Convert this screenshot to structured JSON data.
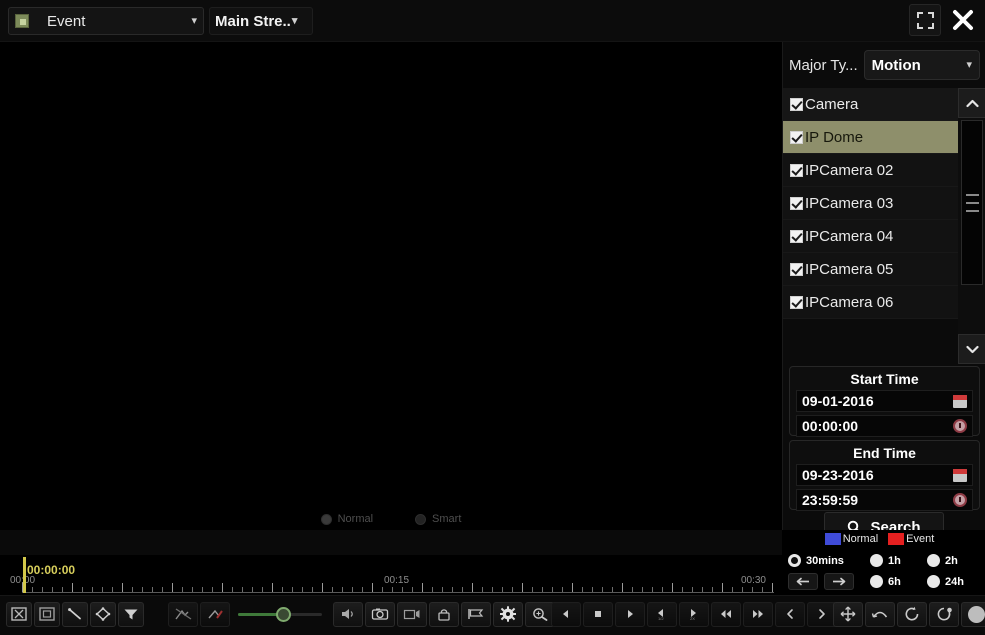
{
  "topbar": {
    "event_type": "Event",
    "stream_type": "Main Stre..",
    "maximize_icon": "fullscreen-icon",
    "close_icon": "close-icon"
  },
  "view_modes": [
    {
      "label": "Normal",
      "selected": true
    },
    {
      "label": "Smart",
      "selected": false
    }
  ],
  "right_panel": {
    "major_type_label": "Major Ty...",
    "major_type_value": "Motion",
    "cameras": [
      {
        "label": "Camera",
        "checked": true,
        "selected": false,
        "header": true
      },
      {
        "label": "IP Dome",
        "checked": true,
        "selected": true
      },
      {
        "label": "IPCamera 02",
        "checked": true,
        "selected": false
      },
      {
        "label": "IPCamera 03",
        "checked": true,
        "selected": false
      },
      {
        "label": "IPCamera 04",
        "checked": true,
        "selected": false
      },
      {
        "label": "IPCamera 05",
        "checked": true,
        "selected": false
      },
      {
        "label": "IPCamera 06",
        "checked": true,
        "selected": false
      }
    ],
    "start_time": {
      "title": "Start Time",
      "date": "09-01-2016",
      "time": "00:00:00"
    },
    "end_time": {
      "title": "End Time",
      "date": "09-23-2016",
      "time": "23:59:59"
    },
    "search_button": "Search"
  },
  "legend": [
    {
      "label": "Normal",
      "color": "#3f4bd8"
    },
    {
      "label": "Event",
      "color": "#e52020"
    }
  ],
  "zoom_levels": [
    {
      "label": "30mins",
      "selected": true
    },
    {
      "label": "1h",
      "selected": false
    },
    {
      "label": "2h",
      "selected": false
    },
    {
      "label": "6h",
      "selected": false
    },
    {
      "label": "24h",
      "selected": false
    }
  ],
  "nav_buttons": [
    {
      "name": "timeline-prev-button",
      "glyph": "←"
    },
    {
      "name": "timeline-next-button",
      "glyph": "→"
    }
  ],
  "timeline": {
    "playhead_time": "00:00:00",
    "ticks": [
      "00:00",
      "00:15",
      "00:30"
    ]
  },
  "toolbar": {
    "group_left": [
      {
        "name": "draw-area-button"
      },
      {
        "name": "clear-area-button"
      },
      {
        "name": "draw-line-button"
      },
      {
        "name": "draw-quad-button"
      },
      {
        "name": "filter-button"
      }
    ],
    "group_mid1": [
      {
        "name": "smart-search-off-button"
      },
      {
        "name": "smart-search-on-button"
      }
    ],
    "group_mid2": [
      {
        "name": "audio-button"
      },
      {
        "name": "snapshot-button"
      },
      {
        "name": "clip-button"
      },
      {
        "name": "lock-button"
      },
      {
        "name": "tag-button"
      },
      {
        "name": "settings-button"
      },
      {
        "name": "digital-zoom-button"
      }
    ],
    "group_play": [
      {
        "name": "reverse-play-button"
      },
      {
        "name": "stop-button"
      },
      {
        "name": "play-button"
      },
      {
        "name": "slow-forward-button"
      },
      {
        "name": "fast-forward-button"
      },
      {
        "name": "rewind-button"
      },
      {
        "name": "forward-button"
      },
      {
        "name": "previous-file-button"
      },
      {
        "name": "next-file-button"
      }
    ],
    "group_right": [
      {
        "name": "ptz-move-button"
      },
      {
        "name": "undo-button"
      },
      {
        "name": "loop-button"
      },
      {
        "name": "partial-loop-button"
      },
      {
        "name": "record-button"
      }
    ]
  }
}
